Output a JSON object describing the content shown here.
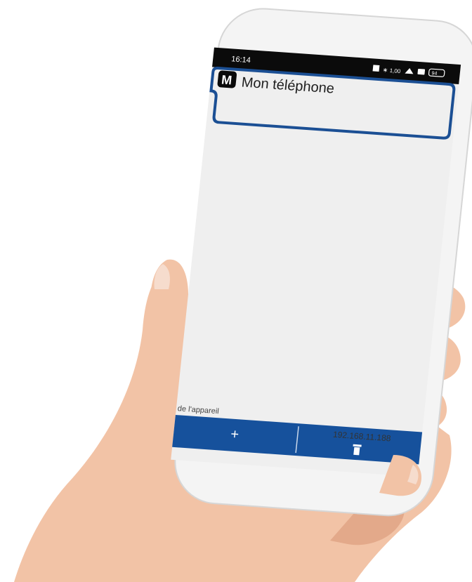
{
  "status_bar": {
    "time": "16:14",
    "icons": [
      "nfc-icon",
      "bluetooth-icon",
      "network-speed-icon",
      "wifi-icon",
      "camera-icon",
      "battery-icon"
    ],
    "network_speed": "1,00",
    "battery": "94"
  },
  "header": {
    "logo_letter": "M",
    "title": "Mon téléphone"
  },
  "footer": {
    "caption": "de l'appareil",
    "ip_address": "192.168.11.188",
    "add_label": "+",
    "delete_icon": "trash-icon"
  },
  "colors": {
    "accent": "#16519c",
    "highlight_border": "#1b4f94",
    "screen_background": "#efefef",
    "status_bar": "#0b0b0b"
  }
}
